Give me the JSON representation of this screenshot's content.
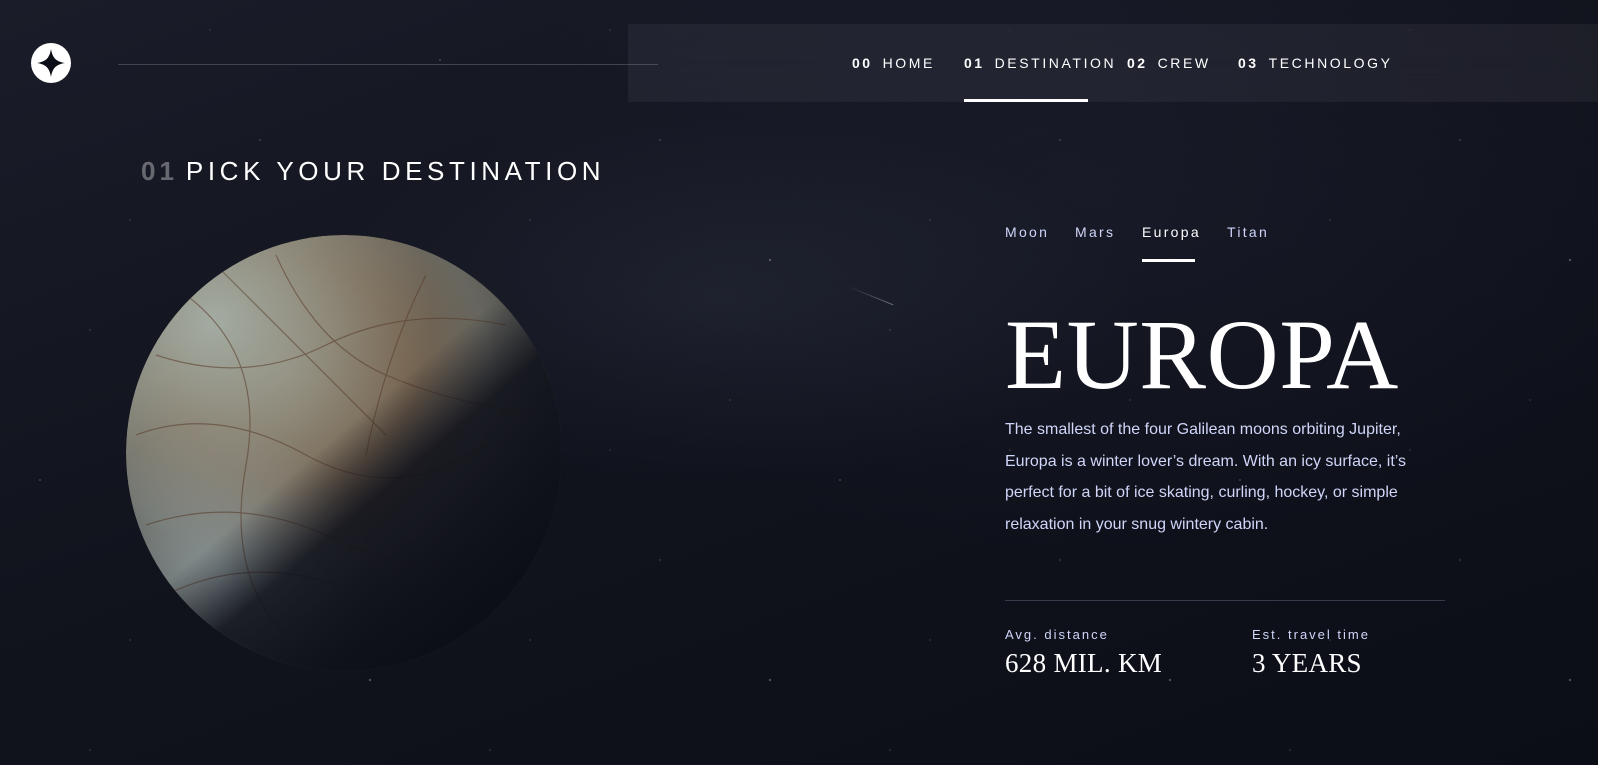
{
  "nav": {
    "items": [
      {
        "num": "00",
        "label": "HOME"
      },
      {
        "num": "01",
        "label": "DESTINATION"
      },
      {
        "num": "02",
        "label": "CREW"
      },
      {
        "num": "03",
        "label": "TECHNOLOGY"
      }
    ],
    "active_index": 1
  },
  "page": {
    "heading_num": "01",
    "heading_text": "PICK YOUR DESTINATION"
  },
  "tabs": [
    "Moon",
    "Mars",
    "Europa",
    "Titan"
  ],
  "active_tab": 2,
  "destination": {
    "name": "EUROPA",
    "description": "The smallest of the four Galilean moons orbiting Jupiter, Europa is a winter lover’s dream. With an icy surface, it’s perfect for a bit of ice skating, curling, hockey, or simple relaxation in your snug wintery cabin.",
    "distance_label": "Avg. distance",
    "distance_value": "628 MIL. KM",
    "travel_label": "Est. travel time",
    "travel_value": "3 YEARS"
  },
  "colors": {
    "background": "#0b0d17",
    "text_light": "#d0d6f9",
    "white": "#ffffff",
    "divider": "#383b4b"
  },
  "icons": {
    "logo": "star-logo-icon"
  }
}
